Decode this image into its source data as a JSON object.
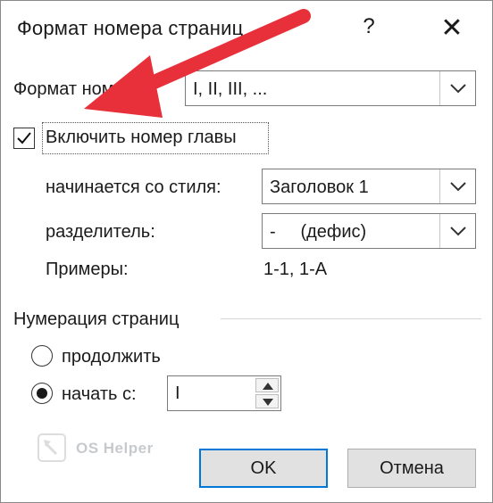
{
  "dialog": {
    "title": "Формат номера страниц",
    "help_glyph": "?",
    "close_glyph": "✕"
  },
  "number_format": {
    "label": "Формат номера:",
    "value": "I, II, III, ..."
  },
  "include_chapter": {
    "label": "Включить номер главы",
    "checked": true
  },
  "chapter_style": {
    "label": "начинается со стиля:",
    "value": "Заголовок 1"
  },
  "separator": {
    "label": "разделитель:",
    "value": "-     (дефис)"
  },
  "examples": {
    "label": "Примеры:",
    "value": "1-1, 1-A"
  },
  "page_numbering": {
    "group_label": "Нумерация страниц",
    "continue_label": "продолжить",
    "start_label": "начать с:",
    "selected": "start",
    "start_value": "I"
  },
  "buttons": {
    "ok": "OK",
    "cancel": "Отмена"
  },
  "watermark": {
    "text": "OS Helper"
  },
  "colors": {
    "accent": "#0078d7",
    "annotation_arrow": "#e8303a"
  }
}
